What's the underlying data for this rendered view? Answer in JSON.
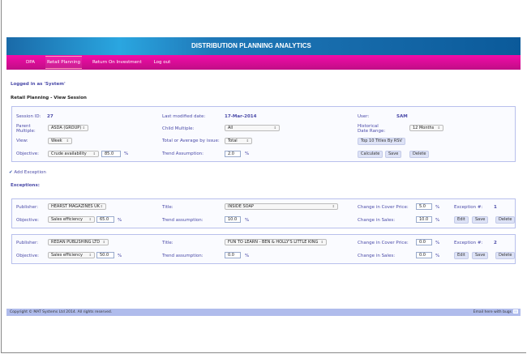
{
  "app": {
    "title": "DISTRIBUTION PLANNING ANALYTICS"
  },
  "nav": [
    "DPA",
    "Retail Planning",
    "Return On Investment",
    "Log out"
  ],
  "logged_in": "Logged in as 'System'",
  "page_title": "Retail Planning - View Session",
  "session": {
    "id_label": "Session ID:",
    "id": "27",
    "modified_label": "Last modified date:",
    "modified": "17-Mar-2014",
    "user_label": "User:",
    "user": "SAM",
    "parent_label": "Parent Multiple:",
    "parent": "ASDA (GROUP)",
    "child_label": "Child Multiple:",
    "child": "All",
    "hist_label": "Historical Date Range:",
    "hist": "12 Months",
    "view_label": "View:",
    "view": "Week",
    "total_label": "Total or Average by issue:",
    "total": "Total",
    "top10": "Top 10 Titles By RSV",
    "objective_label": "Objective:",
    "objective": "Crude availability",
    "objective_value": "85.0",
    "pct": "%",
    "trend_label": "Trend Assumption:",
    "trend": "2.0",
    "calculate": "Calculate",
    "save": "Save",
    "delete": "Delete"
  },
  "add_exception": "Add Exception",
  "exceptions_label": "Exceptions:",
  "exception_labels": {
    "publisher": "Publisher:",
    "title": "Title:",
    "cover": "Change in Cover Price:",
    "number": "Exception #:",
    "objective": "Objective:",
    "trend": "Trend assumption:",
    "sales": "Change in Sales:",
    "edit": "Edit",
    "save": "Save",
    "delete": "Delete",
    "pct": "%"
  },
  "exceptions": [
    {
      "publisher": "HEARST MAGAZINES UK",
      "title": "INSIDE SOAP",
      "cover": "5.0",
      "number": "1",
      "objective": "Sales efficiency",
      "objective_value": "65.0",
      "trend": "10.0",
      "sales": "10.0"
    },
    {
      "publisher": "REDAN PUBLISHING LTD",
      "title": "FUN TO LEARN - BEN & HOLLY'S LITTLE KING",
      "cover": "0.0",
      "number": "2",
      "objective": "Sales efficiency",
      "objective_value": "50.0",
      "trend": "0.0",
      "sales": "0.0"
    }
  ],
  "footer": {
    "copyright": "Copyright © MAT Systems Ltd 2014. All rights reserved.",
    "email": "Email here with bugs"
  }
}
